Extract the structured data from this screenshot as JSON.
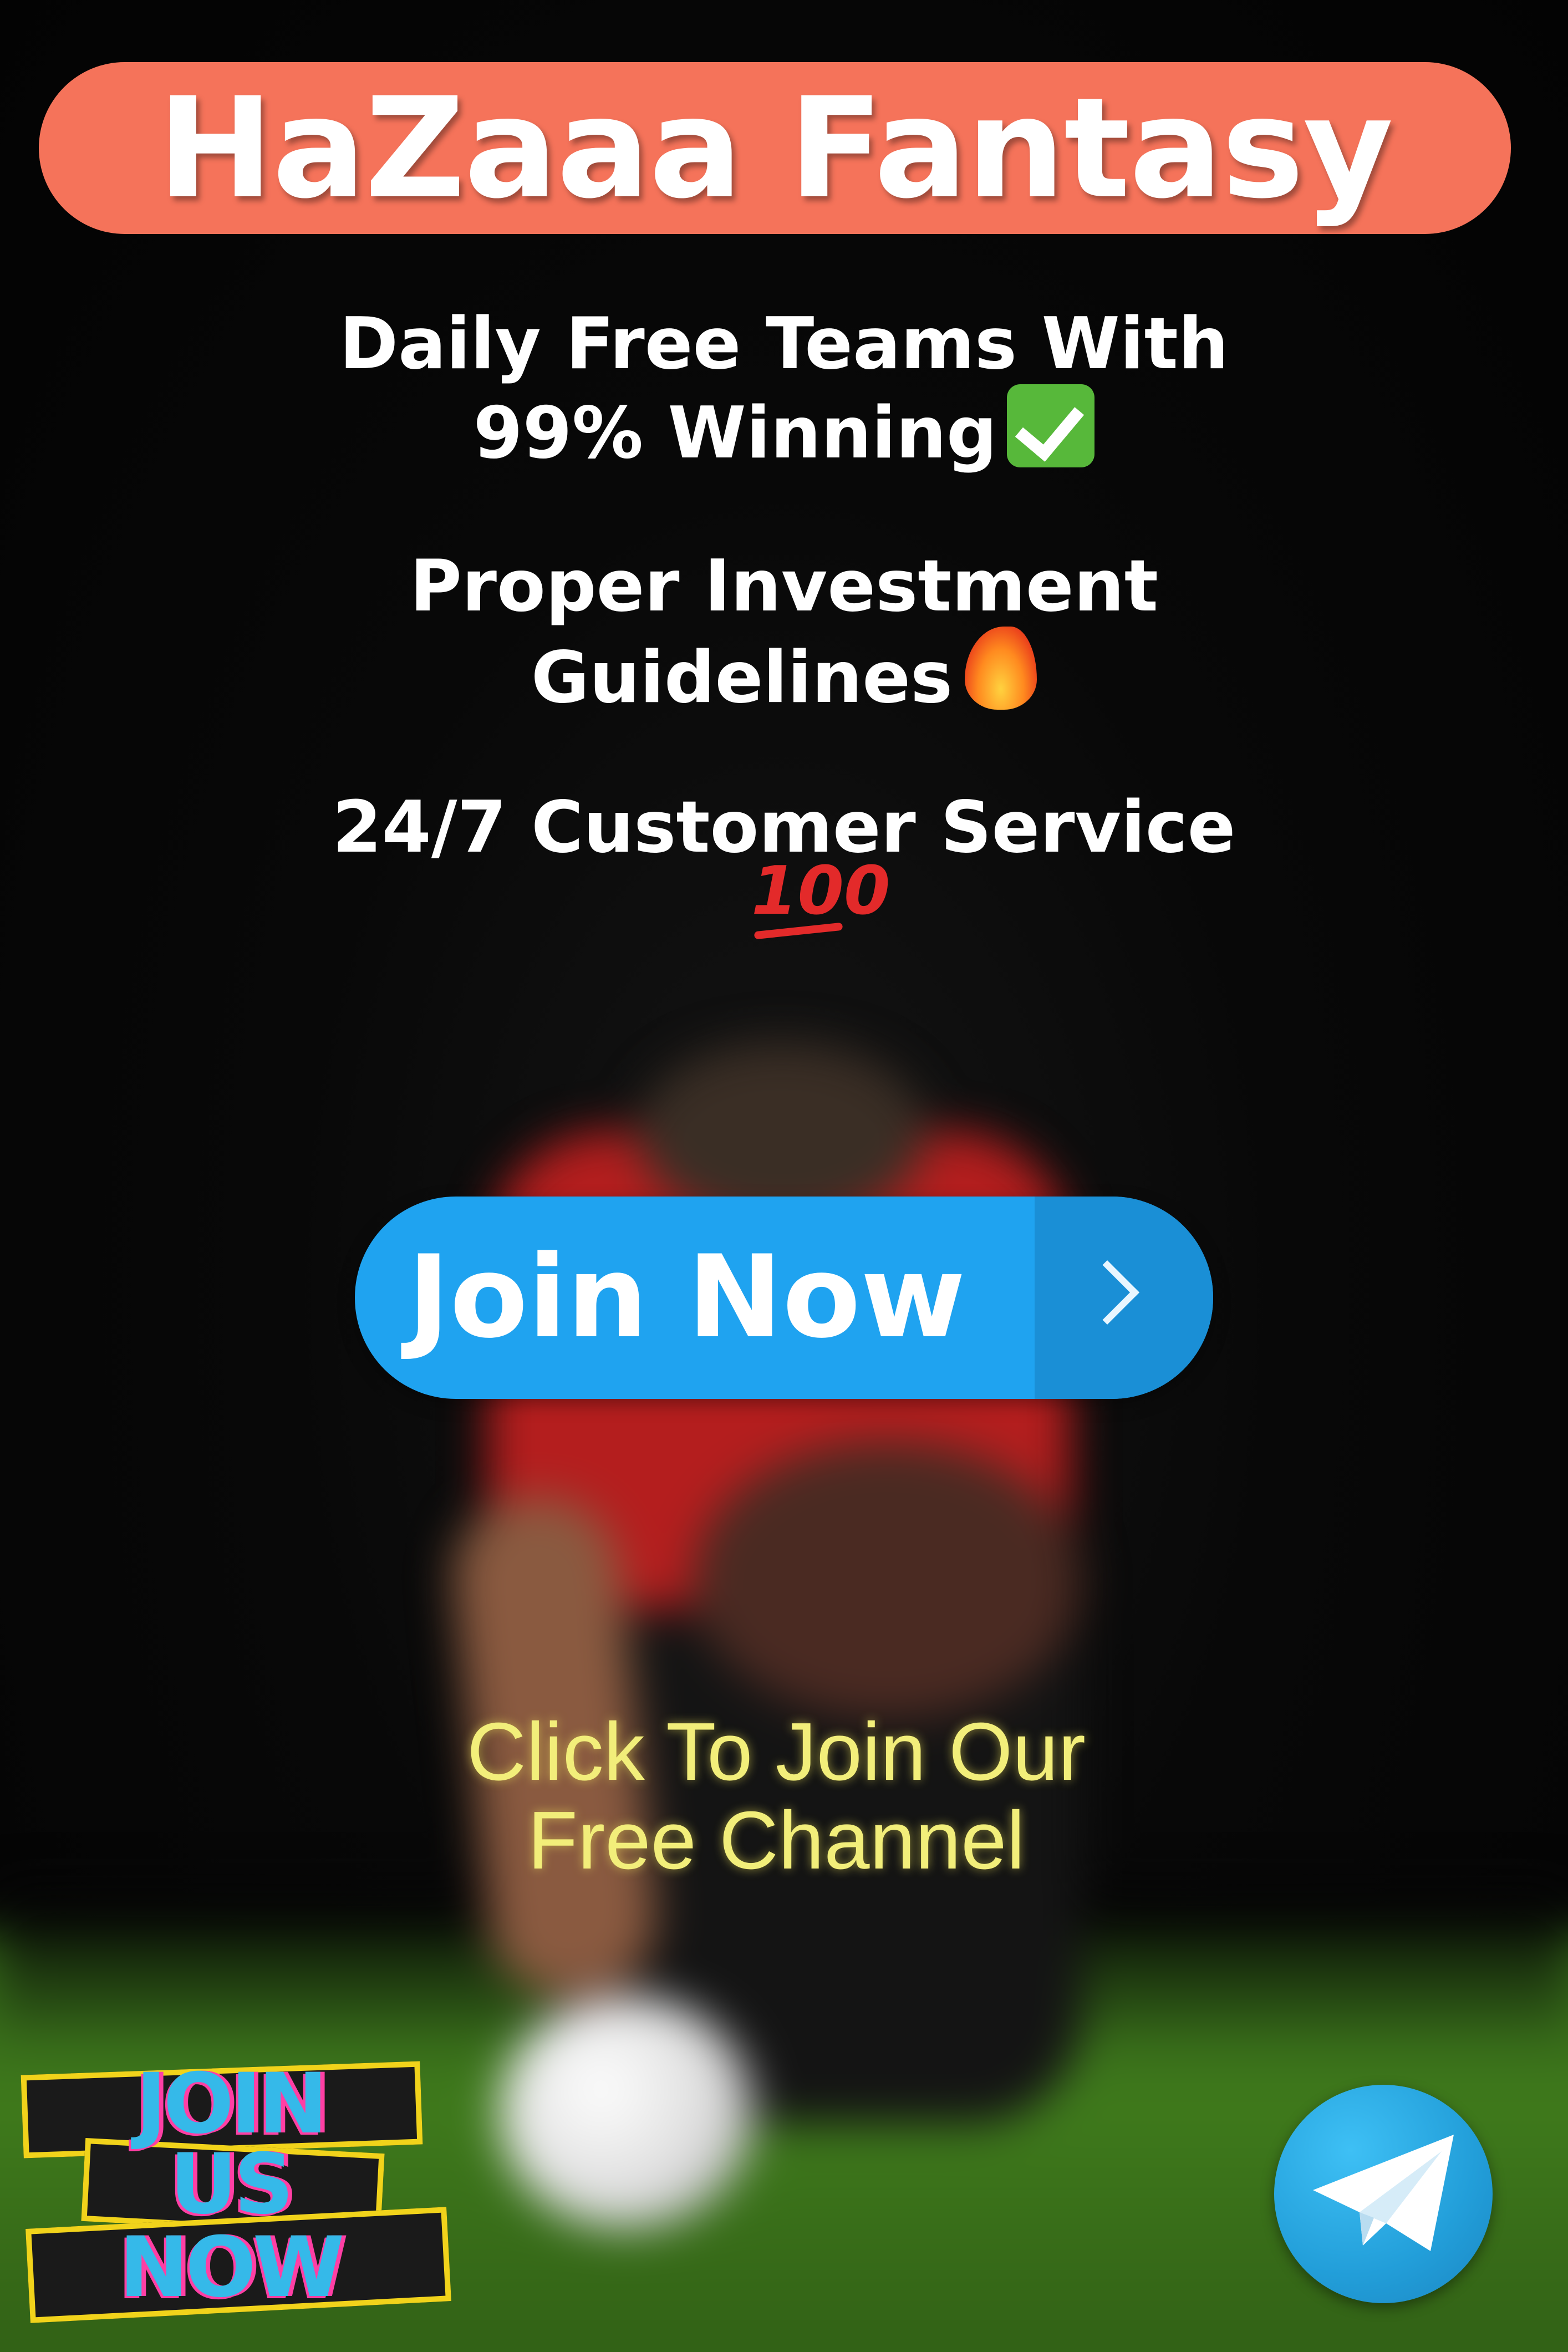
{
  "header": {
    "title": "HaZaaa Fantasy"
  },
  "features": [
    {
      "line1": "Daily Free Teams With",
      "line2": "99% Winning",
      "emoji": "check-mark-icon"
    },
    {
      "line1": "Proper Investment",
      "line2": "Guidelines",
      "emoji": "fire-icon"
    },
    {
      "line1": "24/7 Customer Service",
      "emoji": "hundred-points-icon"
    }
  ],
  "emoji_hundred_text": "100",
  "join_button": {
    "label": "Join Now",
    "icon": "chevron-right-icon"
  },
  "cta": {
    "line1": "Click To Join Our",
    "line2": "Free Channel"
  },
  "sticker": {
    "line1": "JOIN",
    "line2": "US",
    "line3": "NOW"
  },
  "telegram": {
    "icon": "telegram-icon"
  },
  "colors": {
    "title_pill": "#f5735a",
    "button": "#1fa3f0",
    "cta_text": "#f2ee7a",
    "background": "#050505"
  }
}
